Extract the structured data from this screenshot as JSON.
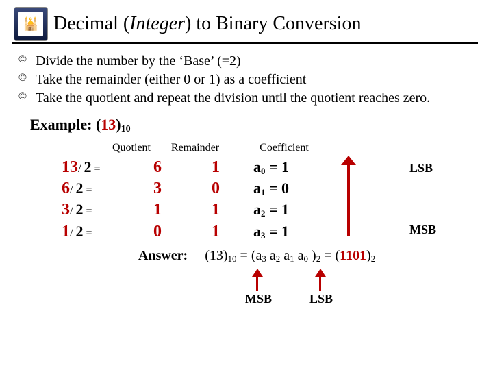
{
  "logo": {
    "glyph": "🕌"
  },
  "title": {
    "pre": "Decimal (",
    "italic": "Integer",
    "post": ") to Binary Conversion"
  },
  "bullets": {
    "sym": "©",
    "b1": "Divide the number by the ‘Base’ (=2)",
    "b2": "Take the remainder (either 0 or 1) as a coefficient",
    "b3": "Take the quotient and repeat the division until the quotient reaches zero."
  },
  "example": {
    "label": "Example: (",
    "num": "13",
    "close": ")",
    "sub": "10"
  },
  "headers": {
    "quotient": "Quotient",
    "remainder": "Remainder",
    "coefficient": "Coefficient"
  },
  "rows": [
    {
      "n": "13",
      "q": "6",
      "r": "1",
      "ai": "0",
      "av": "1"
    },
    {
      "n": "6",
      "q": "3",
      "r": "0",
      "ai": "1",
      "av": "0"
    },
    {
      "n": "3",
      "q": "1",
      "r": "1",
      "ai": "2",
      "av": "1"
    },
    {
      "n": "1",
      "q": "0",
      "r": "1",
      "ai": "3",
      "av": "1"
    }
  ],
  "row_tpl": {
    "slash": "/",
    "two": "2",
    "eq_sm": " =",
    "coef_a": "a",
    "coef_eq": " = "
  },
  "side": {
    "lsb": "LSB",
    "msb": "MSB"
  },
  "answer": {
    "label": "Answer:",
    "p1": "(13)",
    "s1": "10",
    "p2": " = (a",
    "a3": "3",
    "sp": " a",
    "a2": "2",
    "a1": "1",
    "a0": "0",
    "p3": ")",
    "s2": "2",
    "p4": " = (",
    "bin": "1101",
    "p5": ")",
    "s3": "2"
  },
  "bottom": {
    "msb": "MSB",
    "lsb": "LSB"
  }
}
